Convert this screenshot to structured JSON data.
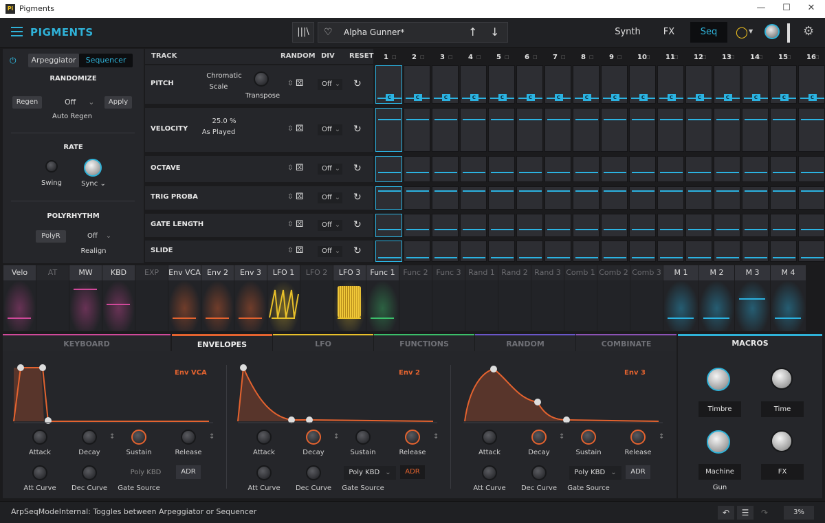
{
  "window": {
    "title": "Pigments",
    "icon": "Pi"
  },
  "topbar": {
    "logo": "PIGMENTS",
    "preset_name": "Alpha Gunner*",
    "tabs": [
      "Synth",
      "FX",
      "Seq"
    ],
    "active_tab": "Seq"
  },
  "left": {
    "modes": [
      "Arpeggiator",
      "Sequencer"
    ],
    "active_mode": "Sequencer",
    "randomize": "RANDOMIZE",
    "regen": "Regen",
    "auto_regen_value": "Off",
    "apply": "Apply",
    "auto_regen": "Auto Regen",
    "rate": "RATE",
    "swing": "Swing",
    "sync": "Sync",
    "polyrhythm": "POLYRHYTHM",
    "polyr": "PolyR",
    "realign_value": "Off",
    "realign": "Realign"
  },
  "seq": {
    "headers": {
      "track": "TRACK",
      "random": "RANDOM",
      "div": "DIV",
      "reset": "RESET"
    },
    "steps": [
      "1",
      "2",
      "3",
      "4",
      "5",
      "6",
      "7",
      "8",
      "9",
      "10",
      "11",
      "12",
      "13",
      "14",
      "15",
      "16"
    ],
    "tracks": [
      {
        "name": "PITCH",
        "param1": "Chromatic",
        "param2": "Scale",
        "knob": "Transpose",
        "div": "Off"
      },
      {
        "name": "VELOCITY",
        "param1": "25.0 %",
        "param2": "As Played",
        "div": "Off"
      },
      {
        "name": "OCTAVE",
        "div": "Off"
      },
      {
        "name": "TRIG PROBA",
        "div": "Off"
      },
      {
        "name": "GATE LENGTH",
        "div": "Off"
      },
      {
        "name": "SLIDE",
        "div": "Off"
      }
    ],
    "pitch_note": "C",
    "velocity_level": 0.75,
    "octave_level": 0.35,
    "trig_level": 0.85,
    "gate_level": 0.3,
    "slide_level": 0.15
  },
  "mods": [
    {
      "label": "Velo",
      "active": true
    },
    {
      "label": "AT",
      "active": false
    },
    {
      "label": "MW",
      "active": true
    },
    {
      "label": "KBD",
      "active": true
    },
    {
      "label": "EXP",
      "active": false
    },
    {
      "label": "Env VCA",
      "active": true
    },
    {
      "label": "Env 2",
      "active": true
    },
    {
      "label": "Env 3",
      "active": true
    },
    {
      "label": "LFO 1",
      "active": true
    },
    {
      "label": "LFO 2",
      "active": false
    },
    {
      "label": "LFO 3",
      "active": true
    },
    {
      "label": "Func 1",
      "active": true
    },
    {
      "label": "Func 2",
      "active": false
    },
    {
      "label": "Func 3",
      "active": false
    },
    {
      "label": "Rand 1",
      "active": false
    },
    {
      "label": "Rand 2",
      "active": false
    },
    {
      "label": "Rand 3",
      "active": false
    },
    {
      "label": "Comb 1",
      "active": false
    },
    {
      "label": "Comb 2",
      "active": false
    },
    {
      "label": "Comb 3",
      "active": false
    },
    {
      "label": "M 1",
      "active": true
    },
    {
      "label": "M 2",
      "active": true
    },
    {
      "label": "M 3",
      "active": true
    },
    {
      "label": "M 4",
      "active": true
    }
  ],
  "bottom_tabs": [
    "KEYBOARD",
    "ENVELOPES",
    "LFO",
    "FUNCTIONS",
    "RANDOM",
    "COMBINATE"
  ],
  "active_bottom_tab": "ENVELOPES",
  "envelopes": [
    {
      "title": "Env VCA",
      "attack": "Attack",
      "decay": "Decay",
      "sustain": "Sustain",
      "release": "Release",
      "att_curve": "Att Curve",
      "dec_curve": "Dec Curve",
      "gate_source": "Gate Source",
      "gate_value": "Poly KBD",
      "mode": "ADR",
      "mode_highlight": false
    },
    {
      "title": "Env 2",
      "attack": "Attack",
      "decay": "Decay",
      "sustain": "Sustain",
      "release": "Release",
      "att_curve": "Att Curve",
      "dec_curve": "Dec Curve",
      "gate_source": "Gate Source",
      "gate_value": "Poly KBD",
      "mode": "ADR",
      "mode_highlight": true
    },
    {
      "title": "Env 3",
      "attack": "Attack",
      "decay": "Decay",
      "sustain": "Sustain",
      "release": "Release",
      "att_curve": "Att Curve",
      "dec_curve": "Dec Curve",
      "gate_source": "Gate Source",
      "gate_value": "Poly KBD",
      "mode": "ADR",
      "mode_highlight": false
    }
  ],
  "macros": {
    "title": "MACROS",
    "items": [
      "Timbre",
      "Time",
      "Machine Gun",
      "FX"
    ]
  },
  "status": {
    "text": "ArpSeqModeInternal: Toggles between Arpeggiator or Sequencer",
    "zoom": "3%"
  },
  "colors": {
    "accent": "#2bb3e2",
    "orange": "#e4632f",
    "pink": "#d0499a",
    "yellow": "#e8c02a",
    "green": "#3bbf6a"
  }
}
